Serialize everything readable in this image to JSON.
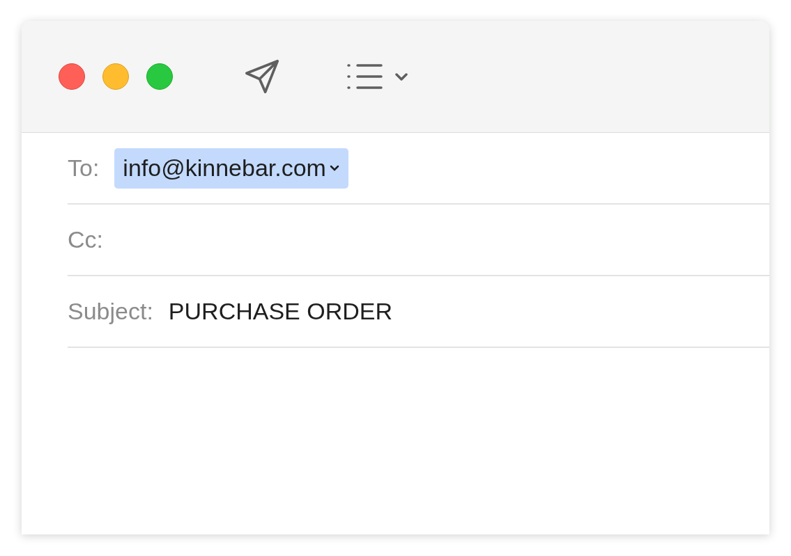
{
  "fields": [
    {
      "kind": "recipients",
      "label": "To:",
      "tokens": [
        "info@kinnebar.com"
      ]
    },
    {
      "kind": "recipients",
      "label": "Cc:"
    },
    {
      "kind": "text",
      "label": "Subject:",
      "value": "PURCHASE ORDER"
    }
  ]
}
